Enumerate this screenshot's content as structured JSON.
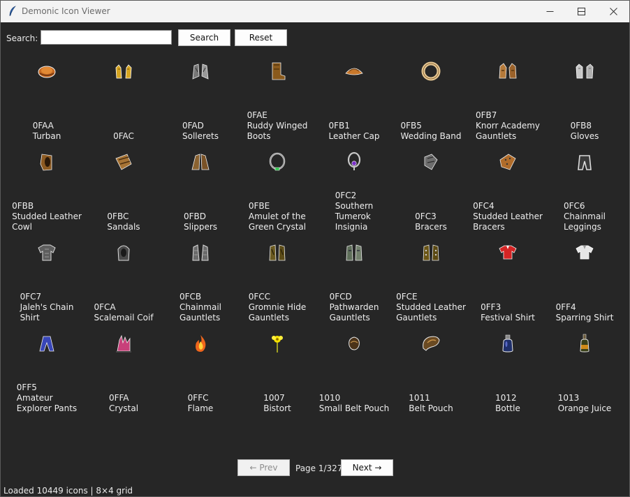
{
  "window": {
    "title": "Demonic Icon Viewer"
  },
  "search": {
    "label": "Search:",
    "value": "",
    "placeholder": "",
    "search_button": "Search",
    "reset_button": "Reset"
  },
  "grid": {
    "items": [
      {
        "code": "0FAA",
        "name": "Turban",
        "icon": "turban-icon"
      },
      {
        "code": "0FAC",
        "name": "",
        "icon": "gloves-gold-icon"
      },
      {
        "code": "0FAD",
        "name": "Sollerets",
        "icon": "sollerets-icon"
      },
      {
        "code": "0FAE",
        "name": "Ruddy Winged\nBoots",
        "icon": "boots-icon"
      },
      {
        "code": "0FB1",
        "name": "Leather Cap",
        "icon": "leather-cap-icon"
      },
      {
        "code": "0FB5",
        "name": "Wedding Band",
        "icon": "ring-icon"
      },
      {
        "code": "0FB7",
        "name": "Knorr Academy\nGauntlets",
        "icon": "gauntlets-icon"
      },
      {
        "code": "0FB8",
        "name": "Gloves",
        "icon": "gloves-icon"
      },
      {
        "code": "0FBB",
        "name": "Studded Leather\nCowl",
        "icon": "cowl-icon"
      },
      {
        "code": "0FBC",
        "name": "Sandals",
        "icon": "sandals-icon"
      },
      {
        "code": "0FBD",
        "name": "Slippers",
        "icon": "slippers-icon"
      },
      {
        "code": "0FBE",
        "name": "Amulet of the\nGreen Crystal",
        "icon": "amulet-icon"
      },
      {
        "code": "0FC2",
        "name": "Southern\nTumerok\nInsignia",
        "icon": "insignia-icon"
      },
      {
        "code": "0FC3",
        "name": "Bracers",
        "icon": "bracers-icon"
      },
      {
        "code": "0FC4",
        "name": "Studded Leather\nBracers",
        "icon": "leather-bracers-icon"
      },
      {
        "code": "0FC6",
        "name": "Chainmail\nLeggings",
        "icon": "leggings-icon"
      },
      {
        "code": "0FC7",
        "name": "Jaleh's Chain\nShirt",
        "icon": "chain-shirt-icon"
      },
      {
        "code": "0FCA",
        "name": "Scalemail Coif",
        "icon": "coif-icon"
      },
      {
        "code": "0FCB",
        "name": "Chainmail\nGauntlets",
        "icon": "chain-gauntlets-icon"
      },
      {
        "code": "0FCC",
        "name": "Gromnie Hide\nGauntlets",
        "icon": "hide-gauntlets-icon"
      },
      {
        "code": "0FCD",
        "name": "Pathwarden\nGauntlets",
        "icon": "pathwarden-gauntlets-icon"
      },
      {
        "code": "0FCE",
        "name": "Studded Leather\nGauntlets",
        "icon": "studded-gauntlets-icon"
      },
      {
        "code": "0FF3",
        "name": "Festival Shirt",
        "icon": "festival-shirt-icon"
      },
      {
        "code": "0FF4",
        "name": "Sparring Shirt",
        "icon": "sparring-shirt-icon"
      },
      {
        "code": "0FF5",
        "name": "Amateur\nExplorer Pants",
        "icon": "pants-icon"
      },
      {
        "code": "0FFA",
        "name": "Crystal",
        "icon": "crystal-icon"
      },
      {
        "code": "0FFC",
        "name": "Flame",
        "icon": "flame-icon"
      },
      {
        "code": "1007",
        "name": "Bistort",
        "icon": "bistort-flower-icon"
      },
      {
        "code": "1010",
        "name": "Small Belt Pouch",
        "icon": "small-pouch-icon"
      },
      {
        "code": "1011",
        "name": "Belt Pouch",
        "icon": "belt-pouch-icon"
      },
      {
        "code": "1012",
        "name": "Bottle",
        "icon": "bottle-icon"
      },
      {
        "code": "1013",
        "name": "Orange Juice",
        "icon": "juice-bottle-icon"
      }
    ]
  },
  "pager": {
    "prev_label": "← Prev",
    "next_label": "Next →",
    "page_text": "Page 1/327"
  },
  "status": {
    "text": "Loaded 10449 icons | 8×4 grid"
  }
}
